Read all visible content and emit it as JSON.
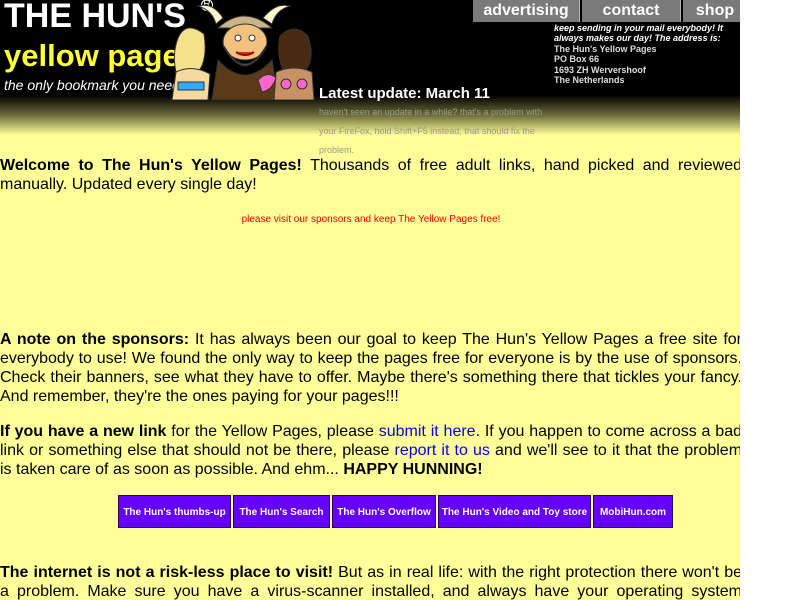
{
  "header": {
    "logo_title": "THE HUN'S",
    "logo_reg": "R",
    "logo_subtitle": "yellow pages",
    "logo_tagline": "the only bookmark you need!",
    "nav": [
      "advertising",
      "contact",
      "shop"
    ],
    "address_note": "keep sending in your mail everybody! It always makes our day! The address is:",
    "address_lines": [
      "The Hun's Yellow Pages",
      "PO Box 66",
      "1693 ZH Wervershoof",
      "The Netherlands"
    ],
    "update_title": "Latest update: March 11",
    "update_text": "haven't seen an update in a while? that's a problem with your FireFox, hold Shift+F5 instead, that should fix the problem."
  },
  "welcome": {
    "lead": "Welcome to The Hun's Yellow Pages!",
    "text": " Thousands of free adult links, hand picked and reviewed manually. Updated every single day!"
  },
  "sponsor_notice": "please visit our sponsors and keep The Yellow Pages free!",
  "sponsors_note": {
    "lead": "A note on the sponsors:",
    "text": " It has always been our goal to keep The Hun's Yellow Pages a free site for everybody to use! We found the only way to keep the pages free for everyone is by the use of sponsors. Check their banners, see what they have to offer. Maybe there's something there that tickles your fancy. And remember, they're the ones paying for your pages!!!"
  },
  "new_link": {
    "lead": "If you have a new link",
    "t1": " for the Yellow Pages, please ",
    "link1": "submit it here",
    "t2": ". If you happen to come across a bad link or something else that should not be there, please ",
    "link2": "report it to us",
    "t3": " and we'll see to it that the problem is taken care of as soon as possible. And ehm... ",
    "end": "HAPPY HUNNING!"
  },
  "buttons": [
    "The Hun's thumbs-up",
    "The Hun's Search",
    "The Hun's Overflow",
    "The Hun's Video and Toy store",
    "MobiHun.com"
  ],
  "safety": {
    "lead": "The internet is not a risk-less place to visit!",
    "text": " But as in real life: with the right protection there won't be a problem. Make sure you have a virus-scanner installed, and always have your operating system updated"
  }
}
